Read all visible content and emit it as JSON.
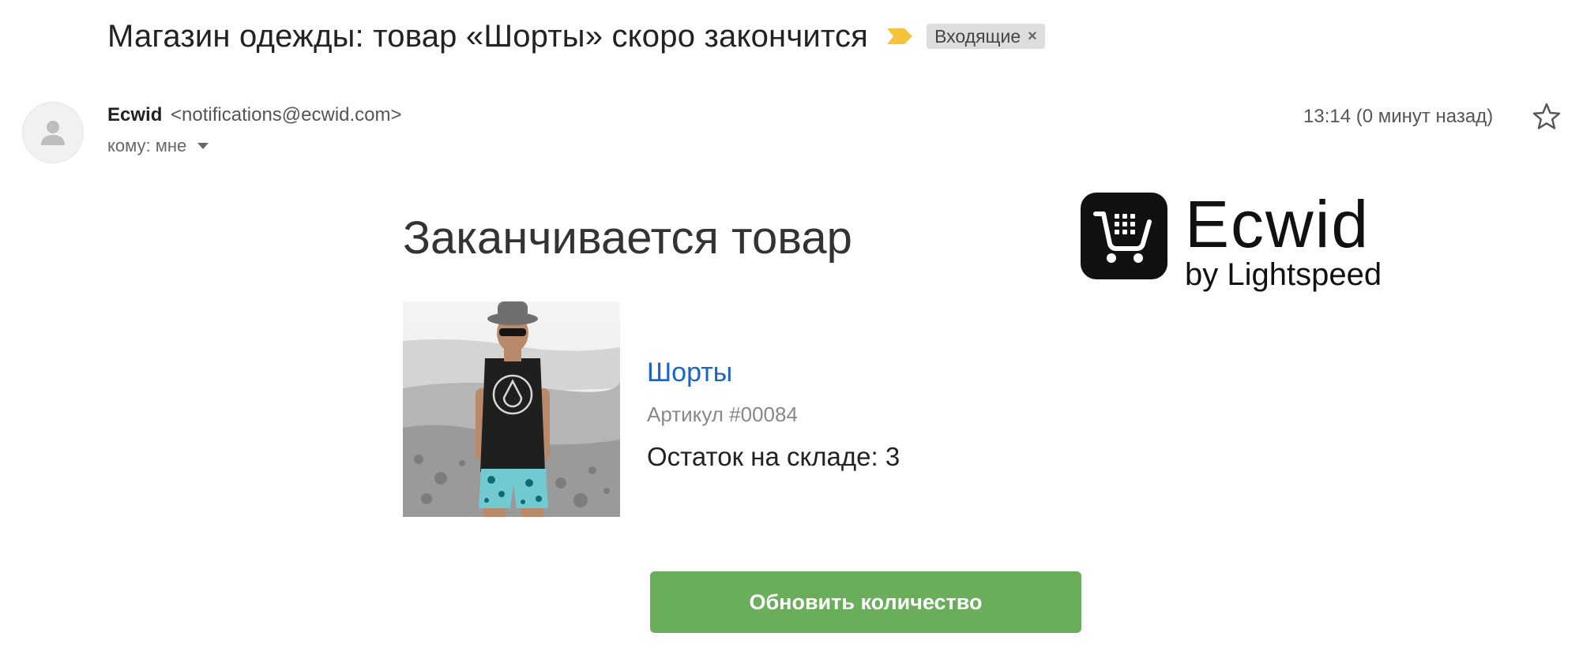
{
  "header": {
    "subject": "Магазин одежды: товар «Шорты» скоро закончится",
    "label_chip": "Входящие",
    "label_chip_close": "×"
  },
  "message": {
    "sender_name": "Ecwid",
    "sender_email": "<notifications@ecwid.com>",
    "recipient": "кому: мне",
    "timestamp": "13:14 (0 минут назад)"
  },
  "email_body": {
    "title": "Заканчивается товар",
    "logo": {
      "word": "Ecwid",
      "sub": "by Lightspeed"
    },
    "product": {
      "name": "Шорты",
      "sku": "Артикул #00084",
      "stock": "Остаток на складе: 3"
    },
    "button_label": "Обновить количество"
  },
  "colors": {
    "link": "#1a63c7",
    "button": "#6aad5b",
    "importance_marker": "#f5c33b",
    "chip_bg": "#dddddd"
  },
  "icons": [
    "importance-marker-icon",
    "avatar-person-icon",
    "dropdown-caret-icon",
    "star-icon",
    "ecwid-cart-icon"
  ]
}
